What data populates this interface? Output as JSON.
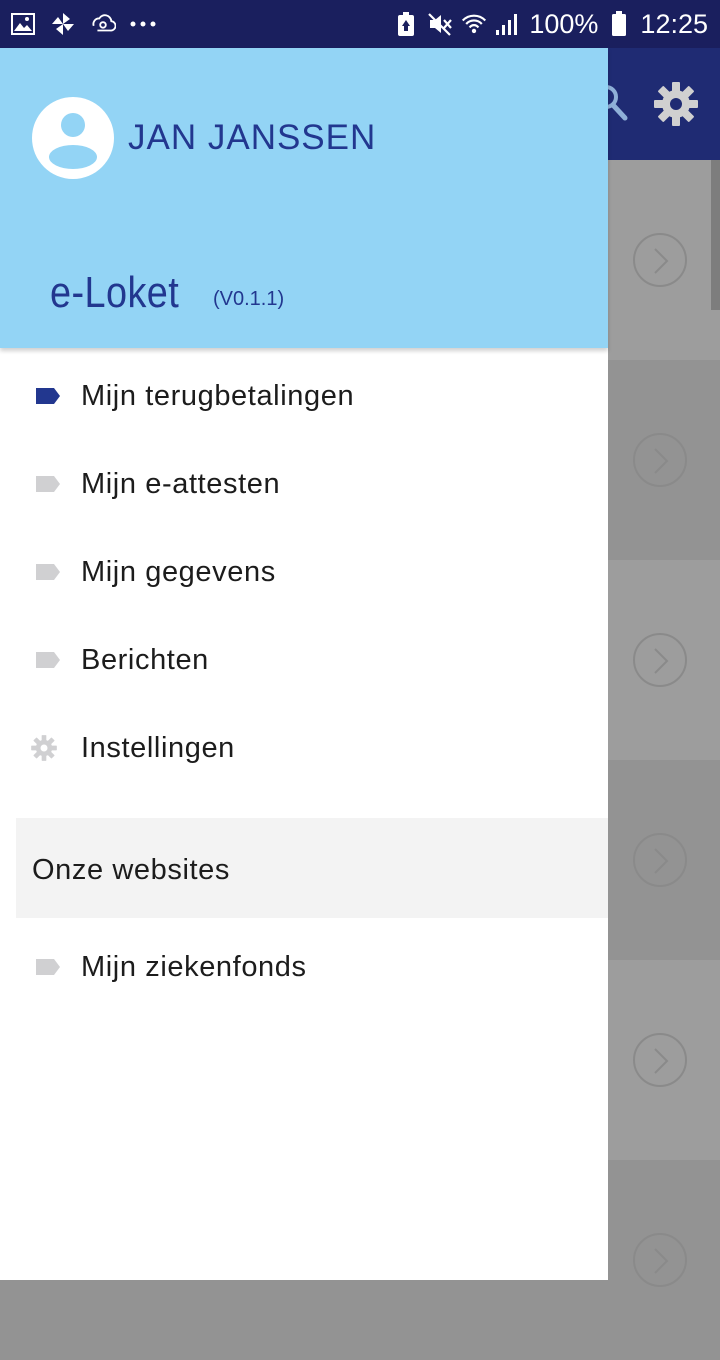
{
  "status_bar": {
    "left_icons": [
      "image-icon",
      "pinwheel-icon",
      "sync-icon",
      "more-dots-icon"
    ],
    "battery_percent": "100%",
    "time": "12:25",
    "right_icons": [
      "battery-saver-icon",
      "mute-icon",
      "wifi-icon",
      "signal-icon",
      "battery-icon"
    ]
  },
  "app_bar": {
    "icons": [
      "search-icon",
      "settings-gear-icon"
    ],
    "color": "#1f2b73"
  },
  "drawer": {
    "header": {
      "user_name": "JAN JANSSEN",
      "app_name": "e-Loket",
      "version": "(V0.1.1)",
      "background": "#93d4f5",
      "text_color": "#22378f"
    },
    "items": [
      {
        "label": "Mijn terugbetalingen",
        "icon": "tag-icon",
        "active": true
      },
      {
        "label": "Mijn e-attesten",
        "icon": "tag-icon",
        "active": false
      },
      {
        "label": "Mijn gegevens",
        "icon": "tag-icon",
        "active": false
      },
      {
        "label": "Berichten",
        "icon": "tag-icon",
        "active": false
      },
      {
        "label": "Instellingen",
        "icon": "gear-icon",
        "active": false
      }
    ],
    "section": {
      "label": "Onze websites",
      "items": [
        {
          "label": "Mijn ziekenfonds",
          "icon": "tag-icon"
        }
      ]
    }
  },
  "colors": {
    "status_bar": "#1a1f5e",
    "active_icon": "#22378f",
    "inactive_icon": "#d0d0d2",
    "scrim_rows": [
      "#9c9c9c",
      "#929292"
    ]
  }
}
